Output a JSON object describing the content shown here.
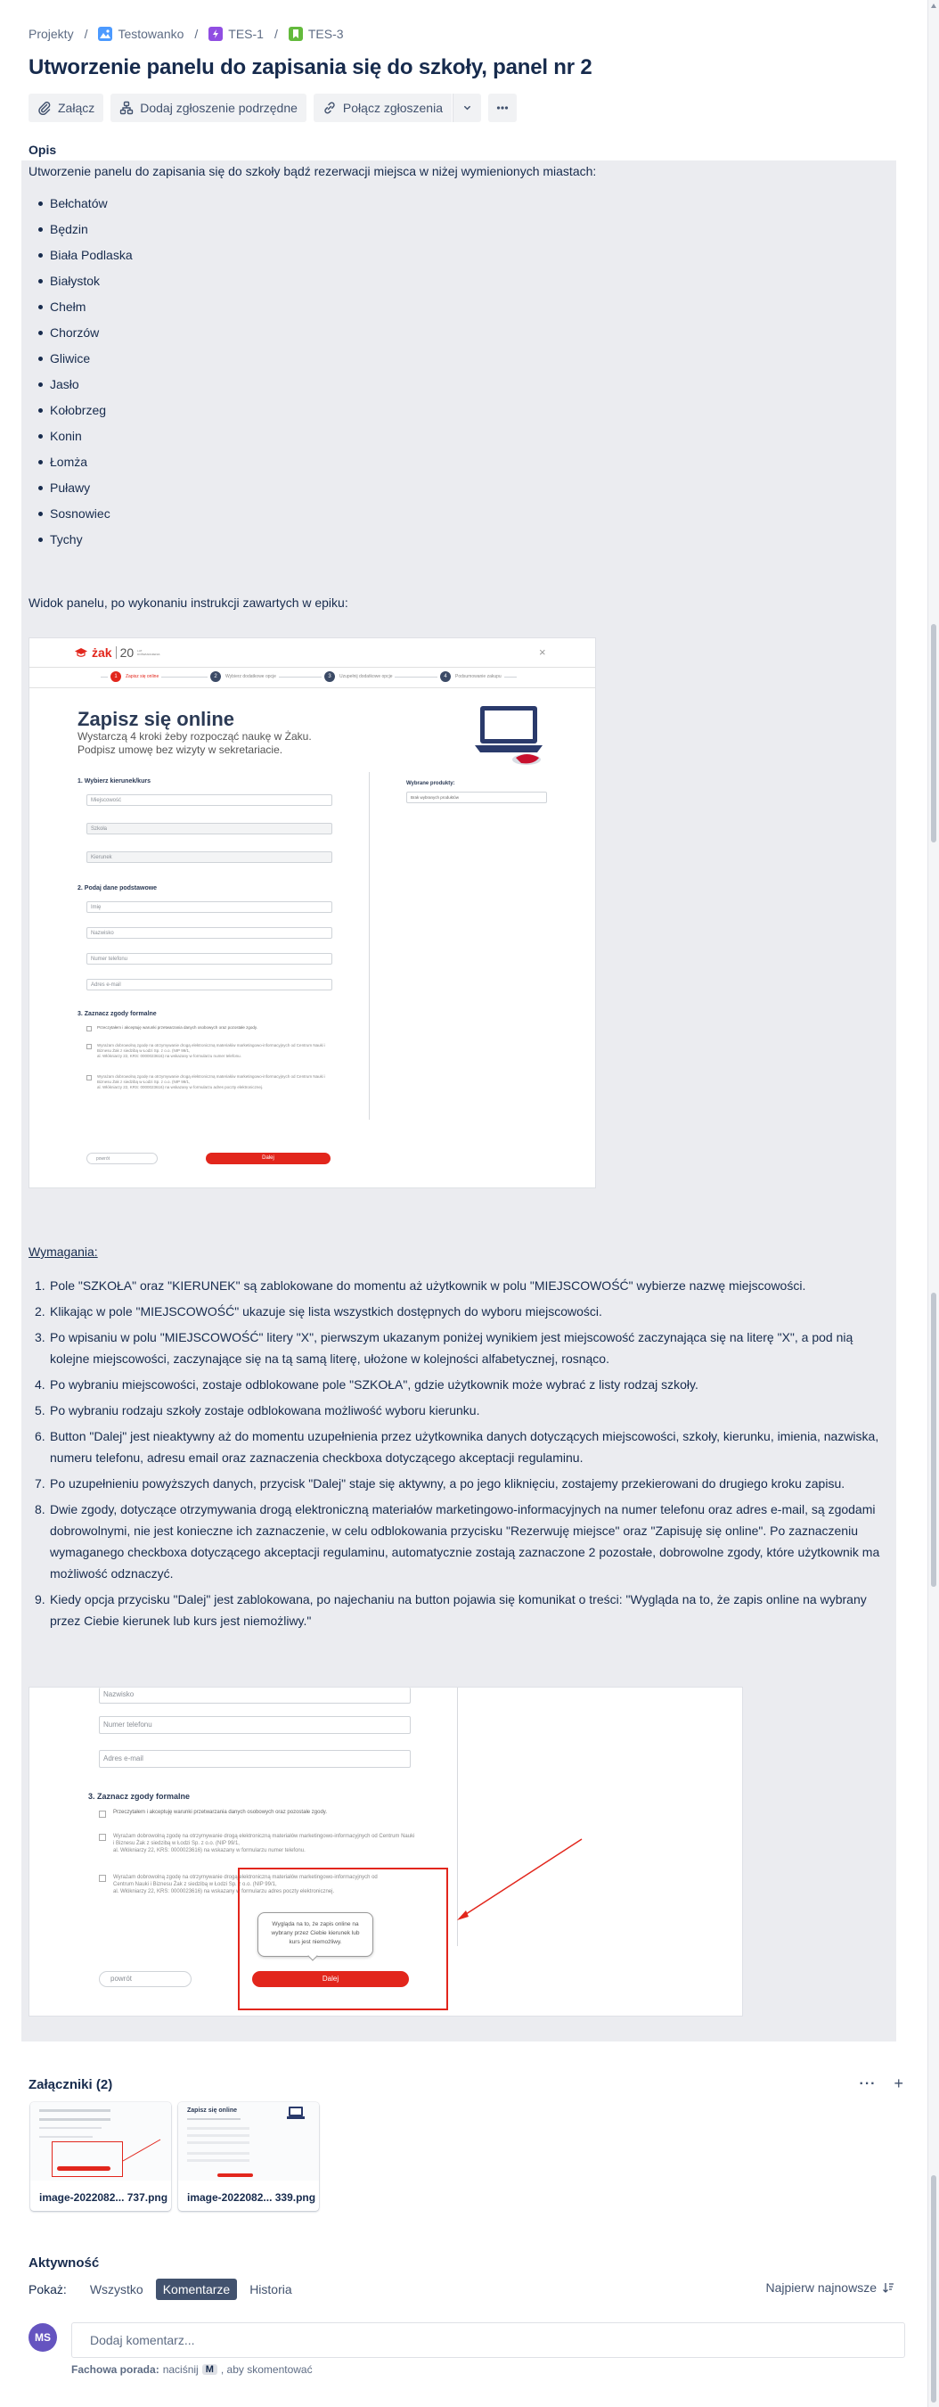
{
  "breadcrumbs": [
    {
      "label": "Projekty"
    },
    {
      "label": "Testowanko"
    },
    {
      "label": "TES-1"
    },
    {
      "label": "TES-3"
    }
  ],
  "issue": {
    "title": "Utworzenie panelu do zapisania się do szkoły, panel nr 2"
  },
  "toolbar": {
    "attach": "Załącz",
    "add_child": "Dodaj zgłoszenie podrzędne",
    "link_issue": "Połącz zgłoszenia"
  },
  "description": {
    "label": "Opis",
    "intro": "Utworzenie panelu do zapisania się do szkoły bądź rezerwacji miejsca w niżej wymienionych miastach:",
    "cities": [
      "Bełchatów",
      "Będzin",
      "Biała Podlaska",
      "Białystok",
      "Chełm",
      "Chorzów",
      "Gliwice",
      "Jasło",
      "Kołobrzeg",
      "Konin",
      "Łomża",
      "Puławy",
      "Sosnowiec",
      "Tychy"
    ],
    "view_label": "Widok panelu, po wykonaniu instrukcji zawartych w epiku:",
    "requirements_label": "Wymagania:",
    "requirements": [
      "Pole \"SZKOŁA\" oraz \"KIERUNEK\" są zablokowane do momentu aż użytkownik w polu \"MIEJSCOWOŚĆ\" wybierze nazwę miejscowości.",
      "Klikając w pole \"MIEJSCOWOŚĆ\" ukazuje się lista wszystkich dostępnych do wyboru miejscowości.",
      "Po wpisaniu w polu \"MIEJSCOWOŚĆ\" litery \"X\", pierwszym ukazanym poniżej wynikiem jest miejscowość zaczynająca się na literę \"X\", a pod nią kolejne miejscowości, zaczynające się na tą samą literę, ułożone w kolejności alfabetycznej, rosnąco.",
      "Po wybraniu miejscowości, zostaje odblokowane pole \"SZKOŁA\", gdzie użytkownik może wybrać z listy rodzaj szkoły.",
      "Po wybraniu rodzaju szkoły zostaje odblokowana możliwość wyboru kierunku.",
      "Button \"Dalej\" jest nieaktywny aż do momentu uzupełnienia przez użytkownika danych dotyczących miejscowości, szkoły, kierunku, imienia, nazwiska, numeru telefonu, adresu email oraz zaznaczenia checkboxa dotyczącego akceptacji regulaminu.",
      "Po uzupełnieniu powyższych danych, przycisk \"Dalej\" staje się aktywny, a po jego kliknięciu, zostajemy przekierowani do drugiego kroku zapisu.",
      "Dwie zgody, dotyczące otrzymywania drogą elektroniczną materiałów marketingowo-informacyjnych na numer telefonu oraz adres e-mail, są zgodami dobrowolnymi, nie jest konieczne ich zaznaczenie, w celu odblokowania przycisku \"Rezerwuję miejsce\" oraz \"Zapisuję się online\". Po zaznaczeniu wymaganego checkboxa dotyczącego akceptacji regulaminu, automatycznie zostają zaznaczone 2 pozostałe, dobrowolne zgody, które użytkownik ma możliwość odznaczyć.",
      "Kiedy opcja przycisku \"Dalej\" jest zablokowana, po najechaniu na button pojawia się komunikat o treści: \"Wygląda na to, że zapis online na wybrany przez Ciebie kierunek lub kurs jest niemożliwy.\""
    ]
  },
  "mockup1": {
    "brand": "żak",
    "brand_num": "20",
    "brand_sub": "LAT DOŚWIADCZENIA",
    "steps": [
      "Zapisz się online",
      "Wybierz dodatkowe opcje",
      "Uzupełnij dodatkowe opcje",
      "Podsumowanie zakupu"
    ],
    "heading": "Zapisz się online",
    "sub1": "Wystarczą 4 kroki żeby rozpocząć naukę w Żaku.",
    "sub2": "Podpisz umowę bez wizyty w sekretariacie.",
    "sec1": "1. Wybierz kierunek/kurs",
    "f_city": "Miejscowość",
    "f_school": "Szkoła",
    "f_course": "Kierunek",
    "sec2": "2. Podaj dane podstawowe",
    "f_name": "Imię",
    "f_surname": "Nazwisko",
    "f_phone": "Numer telefonu",
    "f_email": "Adres e-mail",
    "sec3": "3. Zaznacz zgody formalne",
    "consent1": "Przeczytałem i akceptuję warunki przetwarzania danych osobowych oraz pozostałe zgody.",
    "consent2": "Wyrażam dobrowolną zgodę na otrzymywanie drogą elektroniczną materiałów marketingowo-informacyjnych od Centrum Nauki i Biznesu Żak z siedzibą w Łodzi Sp. z o.o. (NIP 99/1,\nal. Włókniarzy 22, KRS: 0000023616) na wskazany w formularzu numer telefonu.",
    "consent3": "Wyrażam dobrowolną zgodę na otrzymywanie drogą elektroniczną materiałów marketingowo-informacyjnych od Centrum Nauki i Biznesu Żak z siedzibą w Łodzi Sp. z o.o. (NIP 99/1,\nal. Włókniarzy 22, KRS: 0000023616) na wskazany w formularzu adres poczty elektronicznej.",
    "products_label": "Wybrane produkty:",
    "products_value": "Brak wybranych produktów",
    "back": "powrót",
    "next": "Dalej"
  },
  "mockup2": {
    "f_surname": "Nazwisko",
    "f_phone": "Numer telefonu",
    "f_email": "Adres e-mail",
    "sec3": "3. Zaznacz zgody formalne",
    "consent1": "Przeczytałem i akceptuję warunki przetwarzania danych osobowych oraz pozostałe zgody.",
    "consent2": "Wyrażam dobrowolną zgodę na otrzymywanie drogą elektroniczną materiałów marketingowo-informacyjnych od Centrum Nauki i Biznesu Żak z siedzibą w Łodzi Sp. z o.o. (NIP 99/1,\nal. Włókniarzy 22, KRS: 0000023616) na wskazany w formularzu numer telefonu.",
    "consent3": "Wyrażam dobrowolną zgodę na otrzymywanie drogą elektroniczną materiałów marketingowo-informacyjnych od Centrum Nauki i Biznesu Żak z siedzibą w Łodzi Sp. z o.o. (NIP 99/1,\nal. Włókniarzy 22, KRS: 0000023616) na wskazany w formularzu adres poczty elektronicznej.",
    "tooltip": "Wygląda na to, że zapis online na wybrany przez Ciebie kierunek lub kurs jest niemożliwy.",
    "back": "powrót",
    "next": "Dalej"
  },
  "attachments": {
    "title": "Załączniki (2)",
    "items": [
      {
        "name": "image-2022082... 737.png"
      },
      {
        "name": "image-2022082... 339.png"
      }
    ]
  },
  "activity": {
    "title": "Aktywność",
    "show_label": "Pokaż:",
    "filters": [
      "Wszystko",
      "Komentarze",
      "Historia"
    ],
    "active_filter": "Komentarze",
    "sort_label": "Najpierw najnowsze"
  },
  "comment": {
    "avatar_initials": "MS",
    "placeholder": "Dodaj komentarz...",
    "tip_prefix": "Fachowa porada:",
    "tip_mid": "naciśnij",
    "tip_key": "M",
    "tip_suffix": ", aby skomentować"
  },
  "colors": {
    "accent_red": "#e2261c",
    "active_filter_bg": "#42526e",
    "avatar_bg": "#6554c0",
    "panel_bg": "#ebecf0"
  }
}
